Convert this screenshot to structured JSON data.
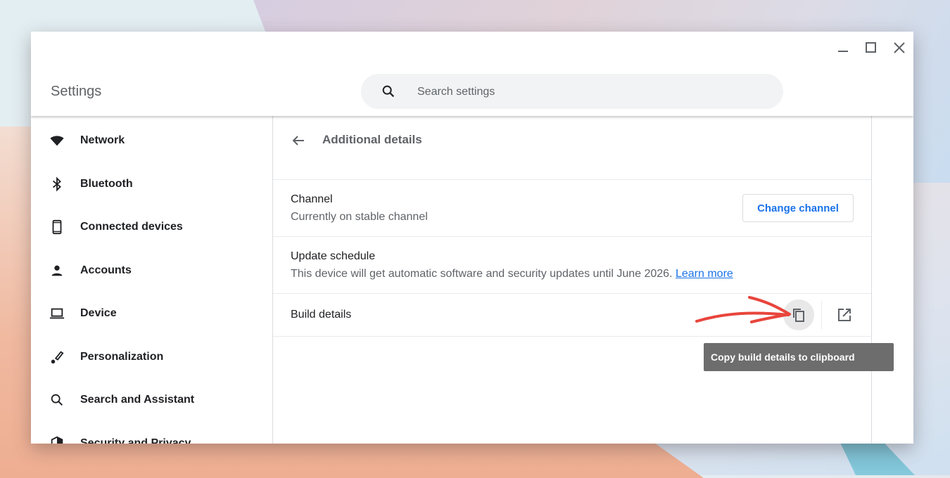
{
  "window": {
    "title": "Settings",
    "controls": [
      "minimize-icon",
      "maximize-icon",
      "close-icon"
    ]
  },
  "search": {
    "placeholder": "Search settings",
    "value": ""
  },
  "sidebar": {
    "items": [
      {
        "label": "Network",
        "icon": "wifi-icon"
      },
      {
        "label": "Bluetooth",
        "icon": "bluetooth-icon"
      },
      {
        "label": "Connected devices",
        "icon": "phone-icon"
      },
      {
        "label": "Accounts",
        "icon": "person-icon"
      },
      {
        "label": "Device",
        "icon": "laptop-icon"
      },
      {
        "label": "Personalization",
        "icon": "brush-icon"
      },
      {
        "label": "Search and Assistant",
        "icon": "search-icon"
      },
      {
        "label": "Security and Privacy",
        "icon": "shield-icon"
      }
    ]
  },
  "page": {
    "title": "Additional details",
    "rows": {
      "channel": {
        "title": "Channel",
        "subtitle": "Currently on stable channel",
        "button": "Change channel"
      },
      "update": {
        "title": "Update schedule",
        "subtitle": "This device will get automatic software and security updates until June 2026.",
        "link": "Learn more"
      },
      "build": {
        "title": "Build details"
      }
    }
  },
  "tooltip": {
    "text": "Copy build details to clipboard"
  },
  "colors": {
    "accent": "#1a73e8",
    "annotation_arrow": "#e8453c",
    "tooltip_bg": "#6d6d6d"
  }
}
